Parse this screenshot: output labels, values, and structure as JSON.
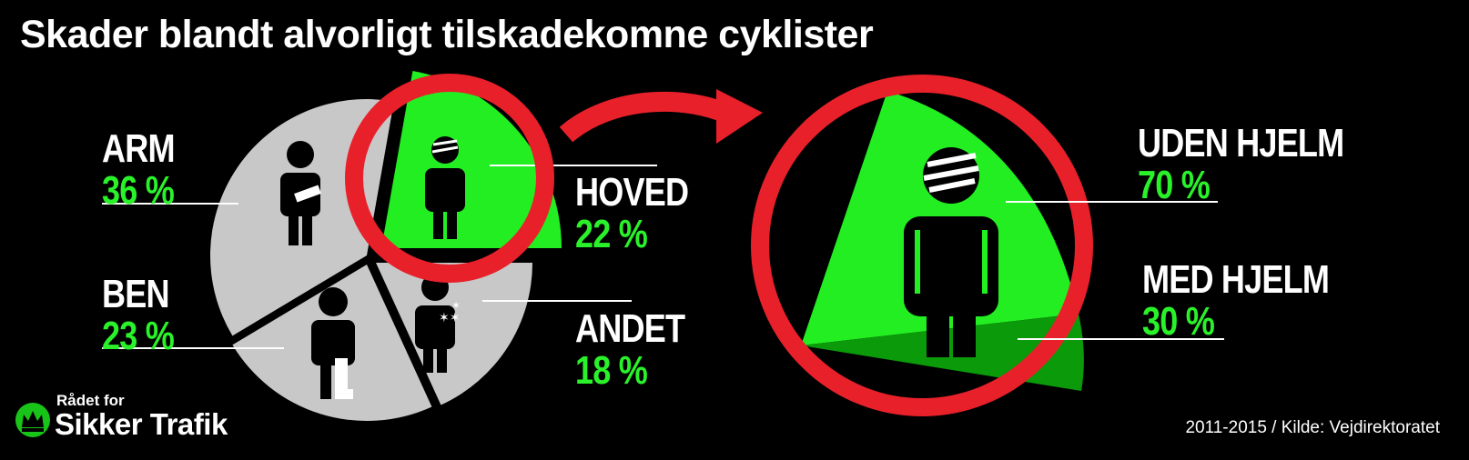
{
  "title": "Skader blandt alvorligt tilskadekomne cyklister",
  "chart_data": [
    {
      "type": "pie",
      "categories": [
        "ARM",
        "HOVED",
        "ANDET",
        "BEN"
      ],
      "values": [
        36,
        22,
        18,
        23
      ],
      "value_labels": [
        "36 %",
        "22 %",
        "18 %",
        "23 %"
      ],
      "highlight": "HOVED"
    },
    {
      "type": "pie",
      "categories": [
        "UDEN HJELM",
        "MED HJELM"
      ],
      "values": [
        70,
        30
      ],
      "value_labels": [
        "70 %",
        "30 %"
      ]
    }
  ],
  "colors": {
    "background": "#000000",
    "slice_grey": "#c8c8c8",
    "highlight_green": "#22ee22",
    "dark_green": "#0a9a0a",
    "value_text": "#2af22a",
    "ring_red": "#e8202a"
  },
  "icons": [
    "person-arm-cast-icon",
    "person-head-bandage-icon",
    "person-dizzy-stars-icon",
    "person-leg-cast-icon",
    "arrow-right-icon",
    "crown-logo-icon"
  ],
  "logo": {
    "small": "Rådet for",
    "big": "Sikker Trafik"
  },
  "source": "2011-2015 / Kilde: Vejdirektoratet"
}
